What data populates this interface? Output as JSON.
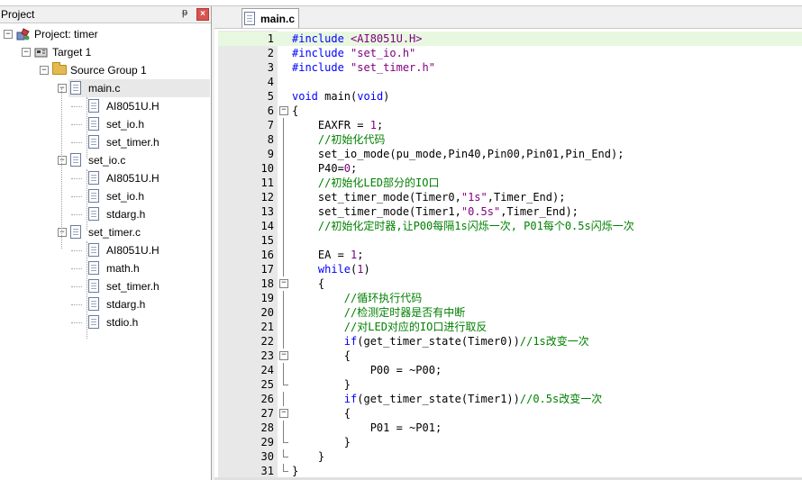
{
  "project_panel": {
    "title": "Project",
    "pin_glyph": "ᵽ",
    "close_glyph": "×",
    "tree": [
      {
        "label": "Project: timer",
        "level": 0,
        "kind": "project",
        "expander": "−"
      },
      {
        "label": "Target 1",
        "level": 1,
        "kind": "target",
        "expander": "−"
      },
      {
        "label": "Source Group 1",
        "level": 2,
        "kind": "folder",
        "expander": "−"
      },
      {
        "label": "main.c",
        "level": 3,
        "kind": "file",
        "expander": "−",
        "selected": true
      },
      {
        "label": "AI8051U.H",
        "level": 4,
        "kind": "file"
      },
      {
        "label": "set_io.h",
        "level": 4,
        "kind": "file"
      },
      {
        "label": "set_timer.h",
        "level": 4,
        "kind": "file"
      },
      {
        "label": "set_io.c",
        "level": 3,
        "kind": "file",
        "expander": "−"
      },
      {
        "label": "AI8051U.H",
        "level": 4,
        "kind": "file"
      },
      {
        "label": "set_io.h",
        "level": 4,
        "kind": "file"
      },
      {
        "label": "stdarg.h",
        "level": 4,
        "kind": "file"
      },
      {
        "label": "set_timer.c",
        "level": 3,
        "kind": "file",
        "expander": "−"
      },
      {
        "label": "AI8051U.H",
        "level": 4,
        "kind": "file"
      },
      {
        "label": "math.h",
        "level": 4,
        "kind": "file"
      },
      {
        "label": "set_timer.h",
        "level": 4,
        "kind": "file"
      },
      {
        "label": "stdarg.h",
        "level": 4,
        "kind": "file"
      },
      {
        "label": "stdio.h",
        "level": 4,
        "kind": "file"
      }
    ]
  },
  "editor": {
    "tab_label": "main.c",
    "lines": [
      {
        "n": "1",
        "fold": "",
        "segs": [
          {
            "t": "#include ",
            "c": "kw"
          },
          {
            "t": "<AI8051U.H>",
            "c": "str"
          }
        ],
        "highlight": true
      },
      {
        "n": "2",
        "fold": "",
        "segs": [
          {
            "t": "#include ",
            "c": "kw"
          },
          {
            "t": "\"set_io.h\"",
            "c": "str"
          }
        ]
      },
      {
        "n": "3",
        "fold": "",
        "segs": [
          {
            "t": "#include ",
            "c": "kw"
          },
          {
            "t": "\"set_timer.h\"",
            "c": "str"
          }
        ]
      },
      {
        "n": "4",
        "fold": "",
        "segs": []
      },
      {
        "n": "5",
        "fold": "",
        "segs": [
          {
            "t": "void",
            "c": "kw"
          },
          {
            "t": " main(",
            "c": ""
          },
          {
            "t": "void",
            "c": "kw"
          },
          {
            "t": ")",
            "c": ""
          }
        ]
      },
      {
        "n": "6",
        "fold": "open",
        "segs": [
          {
            "t": "{",
            "c": ""
          }
        ]
      },
      {
        "n": "7",
        "fold": "line",
        "segs": [
          {
            "t": "    EAXFR = ",
            "c": ""
          },
          {
            "t": "1",
            "c": "num"
          },
          {
            "t": ";",
            "c": ""
          }
        ]
      },
      {
        "n": "8",
        "fold": "line",
        "segs": [
          {
            "t": "    //初始化代码",
            "c": "cm"
          }
        ]
      },
      {
        "n": "9",
        "fold": "line",
        "segs": [
          {
            "t": "    set_io_mode(pu_mode,Pin40,Pin00,Pin01,Pin_End);",
            "c": ""
          }
        ]
      },
      {
        "n": "10",
        "fold": "line",
        "segs": [
          {
            "t": "    P40=",
            "c": ""
          },
          {
            "t": "0",
            "c": "num"
          },
          {
            "t": ";",
            "c": ""
          }
        ]
      },
      {
        "n": "11",
        "fold": "line",
        "segs": [
          {
            "t": "    //初始化LED部分的IO口",
            "c": "cm"
          }
        ]
      },
      {
        "n": "12",
        "fold": "line",
        "segs": [
          {
            "t": "    set_timer_mode(Timer0,",
            "c": ""
          },
          {
            "t": "\"1s\"",
            "c": "str"
          },
          {
            "t": ",Timer_End);",
            "c": ""
          }
        ]
      },
      {
        "n": "13",
        "fold": "line",
        "segs": [
          {
            "t": "    set_timer_mode(Timer1,",
            "c": ""
          },
          {
            "t": "\"0.5s\"",
            "c": "str"
          },
          {
            "t": ",Timer_End);",
            "c": ""
          }
        ]
      },
      {
        "n": "14",
        "fold": "line",
        "segs": [
          {
            "t": "    //初始化定时器,让P00每隔1s闪烁一次, P01每个0.5s闪烁一次",
            "c": "cm"
          }
        ]
      },
      {
        "n": "15",
        "fold": "line",
        "segs": []
      },
      {
        "n": "16",
        "fold": "line",
        "segs": [
          {
            "t": "    EA = ",
            "c": ""
          },
          {
            "t": "1",
            "c": "num"
          },
          {
            "t": ";",
            "c": ""
          }
        ]
      },
      {
        "n": "17",
        "fold": "line",
        "segs": [
          {
            "t": "    ",
            "c": ""
          },
          {
            "t": "while",
            "c": "kw"
          },
          {
            "t": "(",
            "c": ""
          },
          {
            "t": "1",
            "c": "num"
          },
          {
            "t": ")",
            "c": ""
          }
        ]
      },
      {
        "n": "18",
        "fold": "open",
        "segs": [
          {
            "t": "    {",
            "c": ""
          }
        ]
      },
      {
        "n": "19",
        "fold": "line",
        "segs": [
          {
            "t": "        //循环执行代码",
            "c": "cm"
          }
        ]
      },
      {
        "n": "20",
        "fold": "line",
        "segs": [
          {
            "t": "        //检测定时器是否有中断",
            "c": "cm"
          }
        ]
      },
      {
        "n": "21",
        "fold": "line",
        "segs": [
          {
            "t": "        //对LED对应的IO口进行取反",
            "c": "cm"
          }
        ]
      },
      {
        "n": "22",
        "fold": "line",
        "segs": [
          {
            "t": "        ",
            "c": ""
          },
          {
            "t": "if",
            "c": "kw"
          },
          {
            "t": "(get_timer_state(Timer0))",
            "c": ""
          },
          {
            "t": "//1s改变一次",
            "c": "cm"
          }
        ]
      },
      {
        "n": "23",
        "fold": "open",
        "segs": [
          {
            "t": "        {",
            "c": ""
          }
        ]
      },
      {
        "n": "24",
        "fold": "line",
        "segs": [
          {
            "t": "            P00 = ~P00;",
            "c": ""
          }
        ]
      },
      {
        "n": "25",
        "fold": "end",
        "segs": [
          {
            "t": "        }",
            "c": ""
          }
        ]
      },
      {
        "n": "26",
        "fold": "line",
        "segs": [
          {
            "t": "        ",
            "c": ""
          },
          {
            "t": "if",
            "c": "kw"
          },
          {
            "t": "(get_timer_state(Timer1))",
            "c": ""
          },
          {
            "t": "//0.5s改变一次",
            "c": "cm"
          }
        ]
      },
      {
        "n": "27",
        "fold": "open",
        "segs": [
          {
            "t": "        {",
            "c": ""
          }
        ]
      },
      {
        "n": "28",
        "fold": "line",
        "segs": [
          {
            "t": "            P01 = ~P01;",
            "c": ""
          }
        ]
      },
      {
        "n": "29",
        "fold": "end",
        "segs": [
          {
            "t": "        }",
            "c": ""
          }
        ]
      },
      {
        "n": "30",
        "fold": "end",
        "segs": [
          {
            "t": "    }",
            "c": ""
          }
        ]
      },
      {
        "n": "31",
        "fold": "end",
        "segs": [
          {
            "t": "}",
            "c": ""
          }
        ]
      }
    ]
  }
}
